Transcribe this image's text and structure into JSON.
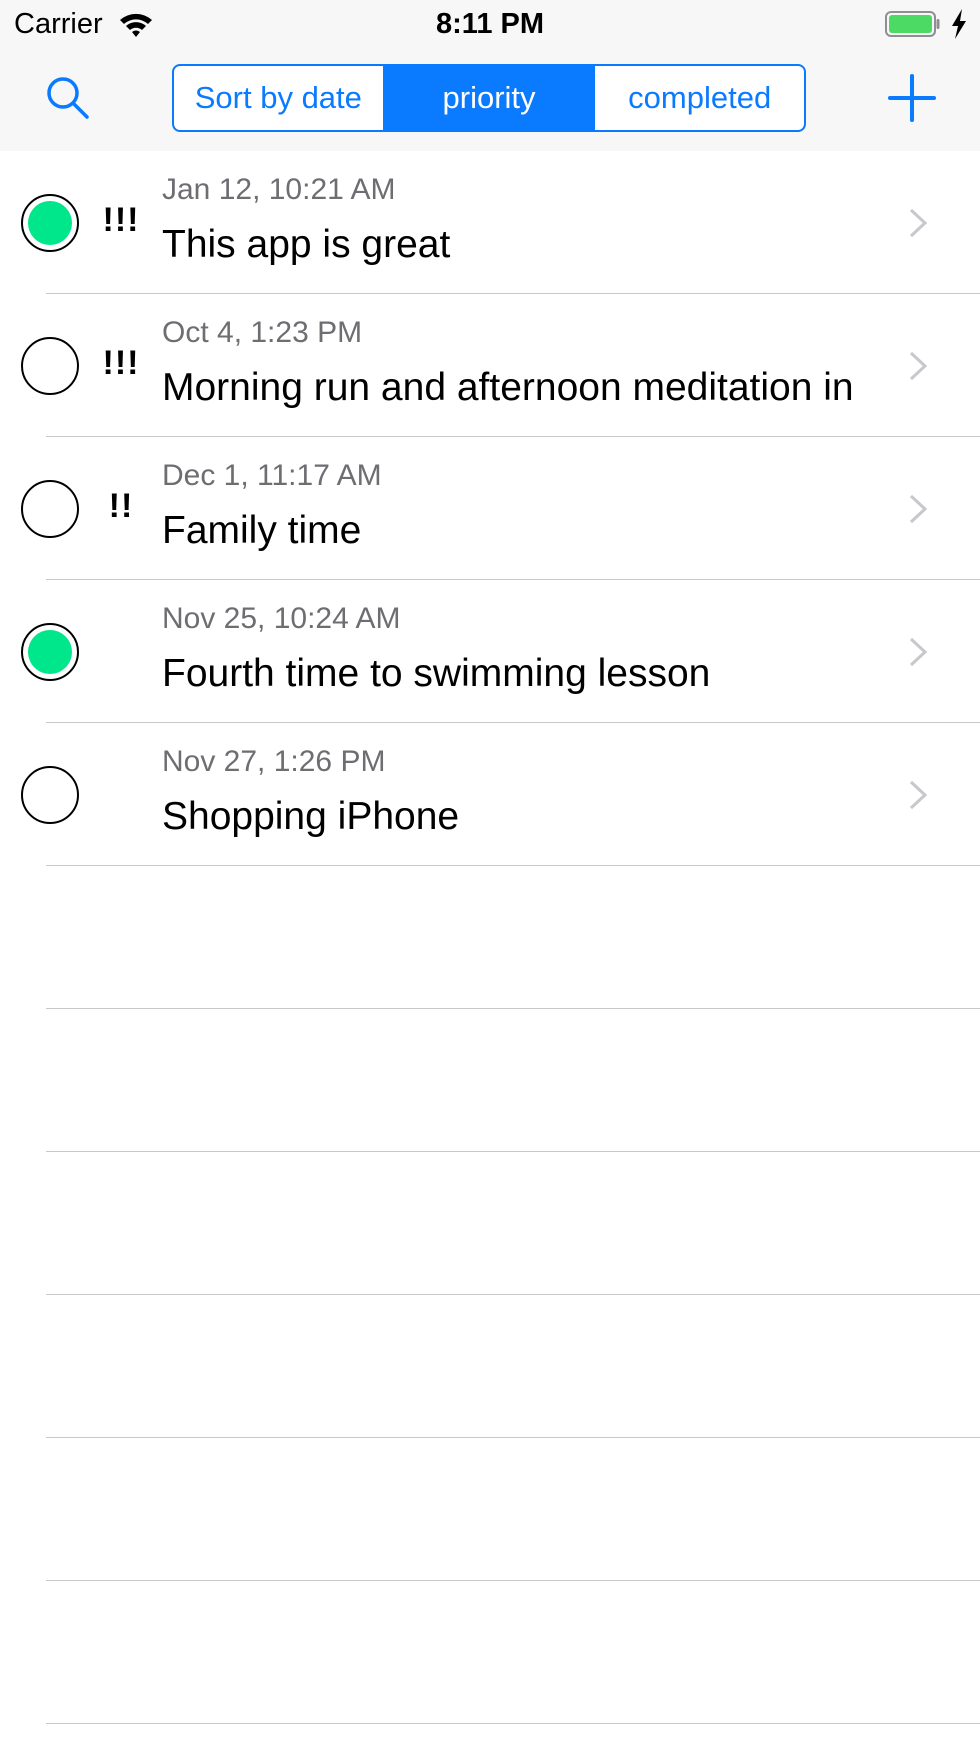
{
  "status_bar": {
    "carrier": "Carrier",
    "time": "8:11 PM",
    "battery_color": "#4cd964"
  },
  "nav": {
    "search_icon": "search-icon",
    "add_icon": "plus-icon",
    "accent_color": "#0a7aff",
    "segments": [
      {
        "label": "Sort by date",
        "selected": false
      },
      {
        "label": "priority",
        "selected": true
      },
      {
        "label": "completed",
        "selected": false
      }
    ]
  },
  "tasks": [
    {
      "date": "Jan 12, 10:21 AM",
      "title": "This app is great",
      "priority": "!!!",
      "completed": true
    },
    {
      "date": "Oct 4, 1:23 PM",
      "title": "Morning run and afternoon meditation in",
      "priority": "!!!",
      "completed": false
    },
    {
      "date": "Dec 1, 11:17 AM",
      "title": "Family time",
      "priority": "!!",
      "completed": false
    },
    {
      "date": "Nov 25, 10:24 AM",
      "title": "Fourth time to swimming lesson",
      "priority": "",
      "completed": true
    },
    {
      "date": "Nov 27, 1:26 PM",
      "title": "Shopping iPhone",
      "priority": "",
      "completed": false
    }
  ],
  "completed_color": "#00e68a"
}
